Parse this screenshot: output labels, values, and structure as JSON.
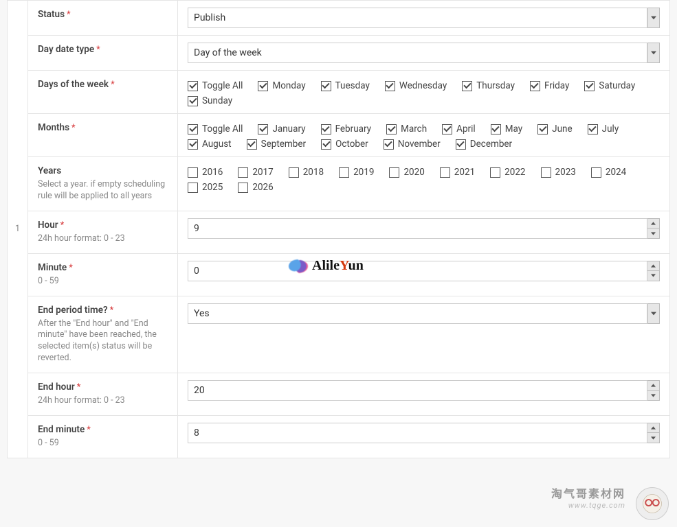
{
  "row_number": "1",
  "status": {
    "label": "Status",
    "value": "Publish"
  },
  "day_date_type": {
    "label": "Day date type",
    "value": "Day of the week"
  },
  "days_of_week": {
    "label": "Days of the week",
    "items": [
      {
        "label": "Toggle All",
        "checked": true
      },
      {
        "label": "Monday",
        "checked": true
      },
      {
        "label": "Tuesday",
        "checked": true
      },
      {
        "label": "Wednesday",
        "checked": true
      },
      {
        "label": "Thursday",
        "checked": true
      },
      {
        "label": "Friday",
        "checked": true
      },
      {
        "label": "Saturday",
        "checked": true
      },
      {
        "label": "Sunday",
        "checked": true
      }
    ]
  },
  "months": {
    "label": "Months",
    "items": [
      {
        "label": "Toggle All",
        "checked": true
      },
      {
        "label": "January",
        "checked": true
      },
      {
        "label": "February",
        "checked": true
      },
      {
        "label": "March",
        "checked": true
      },
      {
        "label": "April",
        "checked": true
      },
      {
        "label": "May",
        "checked": true
      },
      {
        "label": "June",
        "checked": true
      },
      {
        "label": "July",
        "checked": true
      },
      {
        "label": "August",
        "checked": true
      },
      {
        "label": "September",
        "checked": true
      },
      {
        "label": "October",
        "checked": true
      },
      {
        "label": "November",
        "checked": true
      },
      {
        "label": "December",
        "checked": true
      }
    ]
  },
  "years": {
    "label": "Years",
    "hint": "Select a year. if empty scheduling rule will be applied to all years",
    "items": [
      {
        "label": "2016",
        "checked": false
      },
      {
        "label": "2017",
        "checked": false
      },
      {
        "label": "2018",
        "checked": false
      },
      {
        "label": "2019",
        "checked": false
      },
      {
        "label": "2020",
        "checked": false
      },
      {
        "label": "2021",
        "checked": false
      },
      {
        "label": "2022",
        "checked": false
      },
      {
        "label": "2023",
        "checked": false
      },
      {
        "label": "2024",
        "checked": false
      },
      {
        "label": "2025",
        "checked": false
      },
      {
        "label": "2026",
        "checked": false
      }
    ]
  },
  "hour": {
    "label": "Hour",
    "hint": "24h hour format: 0 - 23",
    "value": "9"
  },
  "minute": {
    "label": "Minute",
    "hint": "0 - 59",
    "value": "0"
  },
  "end_period": {
    "label": "End period time?",
    "hint": "After the \"End hour\" and \"End minute\" have been reached, the selected item(s) status will be reverted.",
    "value": "Yes"
  },
  "end_hour": {
    "label": "End hour",
    "hint": "24h hour format: 0 - 23",
    "value": "20"
  },
  "end_minute": {
    "label": "End minute",
    "hint": "0 - 59",
    "value": "8"
  },
  "watermark1": {
    "pre": "Alile",
    "y": "Y",
    "post": "un"
  },
  "watermark2": {
    "zh": "淘气哥素材网",
    "url": "www.tqge.com"
  }
}
